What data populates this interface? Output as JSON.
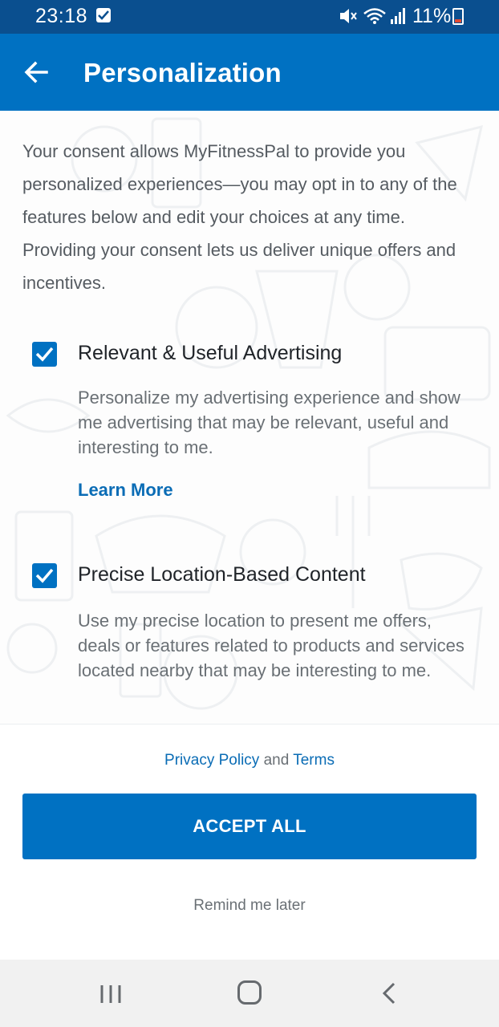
{
  "status_bar": {
    "time": "23:18",
    "battery_percent": "11%",
    "icons": [
      "notification-check-icon",
      "mute-icon",
      "wifi-icon",
      "signal-icon",
      "battery-icon"
    ]
  },
  "app_bar": {
    "title": "Personalization",
    "back_icon": "arrow-left-icon"
  },
  "intro_text": "Your consent allows MyFitnessPal to provide you personalized experiences—you may opt in to any of the features below and edit your choices at any time. Providing your consent lets us deliver unique offers and incentives.",
  "options": [
    {
      "title": "Relevant & Useful Advertising",
      "description": "Personalize my advertising experience and show me advertising that may be relevant, useful and interesting to me.",
      "checked": true,
      "link": "Learn More"
    },
    {
      "title": "Precise Location-Based Content",
      "description": "Use my precise location to present me offers, deals or features related to products and services located nearby that may be interesting to me.",
      "checked": true
    }
  ],
  "footer": {
    "privacy_policy": "Privacy Policy",
    "and": "and",
    "terms": "Terms",
    "accept_all": "ACCEPT ALL",
    "remind_later": "Remind me later"
  },
  "nav_bar": {
    "icons": [
      "recent-apps-icon",
      "home-icon",
      "back-icon"
    ]
  },
  "colors": {
    "status_bar": "#0a4f8f",
    "app_bar": "#0071c2",
    "accent": "#0071c2",
    "link": "#0a6cb5",
    "body_text": "#555b61"
  }
}
